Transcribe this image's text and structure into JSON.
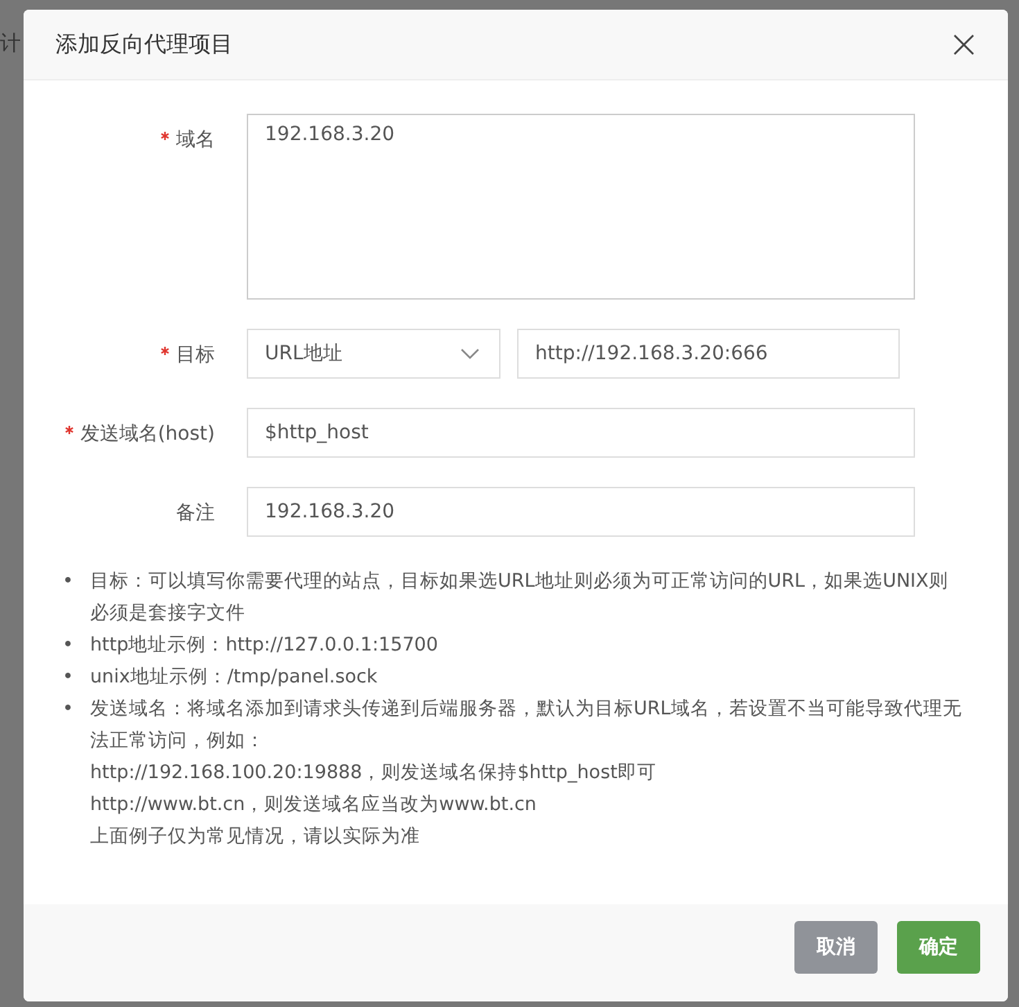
{
  "background_page": {
    "text": "计"
  },
  "dialog": {
    "title": "添加反向代理项目",
    "close": "×"
  },
  "fields": [
    {
      "kind": "textarea",
      "label": "域名",
      "required": true,
      "value": "192.168.3.20"
    },
    {
      "kind": "select_input",
      "label": "目标",
      "required": true,
      "select_value": "URL地址",
      "value": "http://192.168.3.20:666"
    },
    {
      "kind": "input",
      "label": "发送域名(host)",
      "required": true,
      "value": "$http_host"
    },
    {
      "kind": "input",
      "label": "备注",
      "required": false,
      "value": "192.168.3.20"
    }
  ],
  "notes": [
    {
      "bullet": "•",
      "lines": [
        "目标：可以填写你需要代理的站点，目标如果选URL地址则必须为可正常访问的URL，如果选UNIX则必须是套接字文件"
      ]
    },
    {
      "bullet": "•",
      "lines": [
        "http地址示例：http://127.0.0.1:15700"
      ]
    },
    {
      "bullet": "•",
      "lines": [
        "unix地址示例：/tmp/panel.sock"
      ]
    },
    {
      "bullet": "•",
      "lines": [
        "发送域名：将域名添加到请求头传递到后端服务器，默认为目标URL域名，若设置不当可能导致代理无法正常访问，例如：",
        "http://192.168.100.20:19888，则发送域名保持$http_host即可",
        "http://www.bt.cn，则发送域名应当改为www.bt.cn",
        "上面例子仅为常见情况，请以实际为准"
      ]
    }
  ],
  "buttons": [
    {
      "label": "取消",
      "kind": "cancel"
    },
    {
      "label": "确定",
      "kind": "primary"
    }
  ]
}
